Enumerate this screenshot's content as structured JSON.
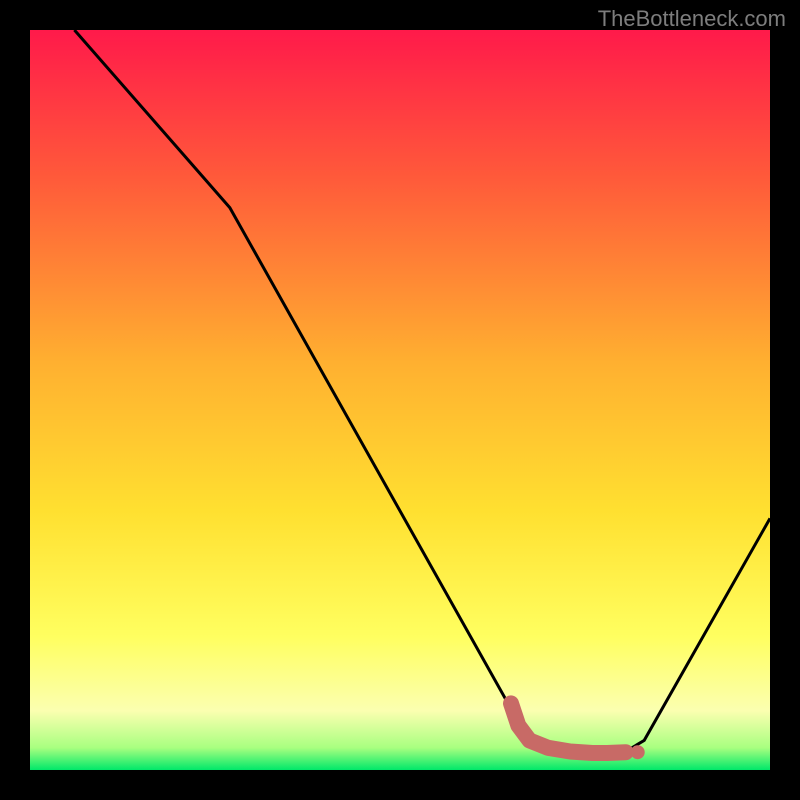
{
  "watermark": "TheBottleneck.com",
  "chart_data": {
    "type": "line",
    "title": "",
    "xlabel": "",
    "ylabel": "",
    "xlim": [
      0,
      100
    ],
    "ylim": [
      0,
      100
    ],
    "gradient_stops": [
      {
        "offset": 0,
        "color": "#ff1a4a"
      },
      {
        "offset": 20,
        "color": "#ff5a3a"
      },
      {
        "offset": 45,
        "color": "#ffb030"
      },
      {
        "offset": 65,
        "color": "#ffe030"
      },
      {
        "offset": 82,
        "color": "#ffff60"
      },
      {
        "offset": 92,
        "color": "#fbffb0"
      },
      {
        "offset": 97,
        "color": "#a8ff80"
      },
      {
        "offset": 100,
        "color": "#00e86a"
      }
    ],
    "series": [
      {
        "name": "bottleneck-curve",
        "color": "#000000",
        "points": [
          {
            "x": 6,
            "y": 100
          },
          {
            "x": 27,
            "y": 76
          },
          {
            "x": 66,
            "y": 6.5
          },
          {
            "x": 70,
            "y": 3
          },
          {
            "x": 76,
            "y": 2
          },
          {
            "x": 80,
            "y": 2.2
          },
          {
            "x": 83,
            "y": 4
          },
          {
            "x": 100,
            "y": 34
          }
        ]
      }
    ],
    "highlight": {
      "name": "optimal-range",
      "color": "#c86a66",
      "points": [
        {
          "x": 65,
          "y": 9
        },
        {
          "x": 66,
          "y": 6
        },
        {
          "x": 67.5,
          "y": 4
        },
        {
          "x": 70,
          "y": 3
        },
        {
          "x": 73,
          "y": 2.5
        },
        {
          "x": 76,
          "y": 2.3
        },
        {
          "x": 78,
          "y": 2.3
        },
        {
          "x": 80.5,
          "y": 2.4
        }
      ]
    }
  }
}
